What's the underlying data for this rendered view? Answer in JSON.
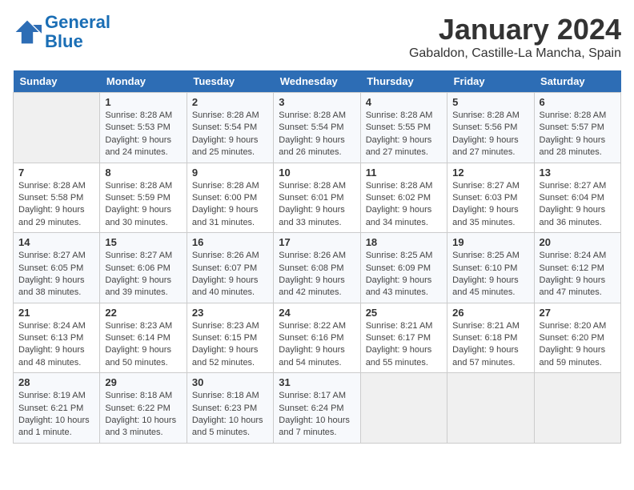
{
  "header": {
    "logo_line1": "General",
    "logo_line2": "Blue",
    "main_title": "January 2024",
    "subtitle": "Gabaldon, Castille-La Mancha, Spain"
  },
  "calendar": {
    "days_of_week": [
      "Sunday",
      "Monday",
      "Tuesday",
      "Wednesday",
      "Thursday",
      "Friday",
      "Saturday"
    ],
    "weeks": [
      [
        {
          "day": "",
          "content": ""
        },
        {
          "day": "1",
          "content": "Sunrise: 8:28 AM\nSunset: 5:53 PM\nDaylight: 9 hours\nand 24 minutes."
        },
        {
          "day": "2",
          "content": "Sunrise: 8:28 AM\nSunset: 5:54 PM\nDaylight: 9 hours\nand 25 minutes."
        },
        {
          "day": "3",
          "content": "Sunrise: 8:28 AM\nSunset: 5:54 PM\nDaylight: 9 hours\nand 26 minutes."
        },
        {
          "day": "4",
          "content": "Sunrise: 8:28 AM\nSunset: 5:55 PM\nDaylight: 9 hours\nand 27 minutes."
        },
        {
          "day": "5",
          "content": "Sunrise: 8:28 AM\nSunset: 5:56 PM\nDaylight: 9 hours\nand 27 minutes."
        },
        {
          "day": "6",
          "content": "Sunrise: 8:28 AM\nSunset: 5:57 PM\nDaylight: 9 hours\nand 28 minutes."
        }
      ],
      [
        {
          "day": "7",
          "content": "Sunrise: 8:28 AM\nSunset: 5:58 PM\nDaylight: 9 hours\nand 29 minutes."
        },
        {
          "day": "8",
          "content": "Sunrise: 8:28 AM\nSunset: 5:59 PM\nDaylight: 9 hours\nand 30 minutes."
        },
        {
          "day": "9",
          "content": "Sunrise: 8:28 AM\nSunset: 6:00 PM\nDaylight: 9 hours\nand 31 minutes."
        },
        {
          "day": "10",
          "content": "Sunrise: 8:28 AM\nSunset: 6:01 PM\nDaylight: 9 hours\nand 33 minutes."
        },
        {
          "day": "11",
          "content": "Sunrise: 8:28 AM\nSunset: 6:02 PM\nDaylight: 9 hours\nand 34 minutes."
        },
        {
          "day": "12",
          "content": "Sunrise: 8:27 AM\nSunset: 6:03 PM\nDaylight: 9 hours\nand 35 minutes."
        },
        {
          "day": "13",
          "content": "Sunrise: 8:27 AM\nSunset: 6:04 PM\nDaylight: 9 hours\nand 36 minutes."
        }
      ],
      [
        {
          "day": "14",
          "content": "Sunrise: 8:27 AM\nSunset: 6:05 PM\nDaylight: 9 hours\nand 38 minutes."
        },
        {
          "day": "15",
          "content": "Sunrise: 8:27 AM\nSunset: 6:06 PM\nDaylight: 9 hours\nand 39 minutes."
        },
        {
          "day": "16",
          "content": "Sunrise: 8:26 AM\nSunset: 6:07 PM\nDaylight: 9 hours\nand 40 minutes."
        },
        {
          "day": "17",
          "content": "Sunrise: 8:26 AM\nSunset: 6:08 PM\nDaylight: 9 hours\nand 42 minutes."
        },
        {
          "day": "18",
          "content": "Sunrise: 8:25 AM\nSunset: 6:09 PM\nDaylight: 9 hours\nand 43 minutes."
        },
        {
          "day": "19",
          "content": "Sunrise: 8:25 AM\nSunset: 6:10 PM\nDaylight: 9 hours\nand 45 minutes."
        },
        {
          "day": "20",
          "content": "Sunrise: 8:24 AM\nSunset: 6:12 PM\nDaylight: 9 hours\nand 47 minutes."
        }
      ],
      [
        {
          "day": "21",
          "content": "Sunrise: 8:24 AM\nSunset: 6:13 PM\nDaylight: 9 hours\nand 48 minutes."
        },
        {
          "day": "22",
          "content": "Sunrise: 8:23 AM\nSunset: 6:14 PM\nDaylight: 9 hours\nand 50 minutes."
        },
        {
          "day": "23",
          "content": "Sunrise: 8:23 AM\nSunset: 6:15 PM\nDaylight: 9 hours\nand 52 minutes."
        },
        {
          "day": "24",
          "content": "Sunrise: 8:22 AM\nSunset: 6:16 PM\nDaylight: 9 hours\nand 54 minutes."
        },
        {
          "day": "25",
          "content": "Sunrise: 8:21 AM\nSunset: 6:17 PM\nDaylight: 9 hours\nand 55 minutes."
        },
        {
          "day": "26",
          "content": "Sunrise: 8:21 AM\nSunset: 6:18 PM\nDaylight: 9 hours\nand 57 minutes."
        },
        {
          "day": "27",
          "content": "Sunrise: 8:20 AM\nSunset: 6:20 PM\nDaylight: 9 hours\nand 59 minutes."
        }
      ],
      [
        {
          "day": "28",
          "content": "Sunrise: 8:19 AM\nSunset: 6:21 PM\nDaylight: 10 hours\nand 1 minute."
        },
        {
          "day": "29",
          "content": "Sunrise: 8:18 AM\nSunset: 6:22 PM\nDaylight: 10 hours\nand 3 minutes."
        },
        {
          "day": "30",
          "content": "Sunrise: 8:18 AM\nSunset: 6:23 PM\nDaylight: 10 hours\nand 5 minutes."
        },
        {
          "day": "31",
          "content": "Sunrise: 8:17 AM\nSunset: 6:24 PM\nDaylight: 10 hours\nand 7 minutes."
        },
        {
          "day": "",
          "content": ""
        },
        {
          "day": "",
          "content": ""
        },
        {
          "day": "",
          "content": ""
        }
      ]
    ]
  }
}
